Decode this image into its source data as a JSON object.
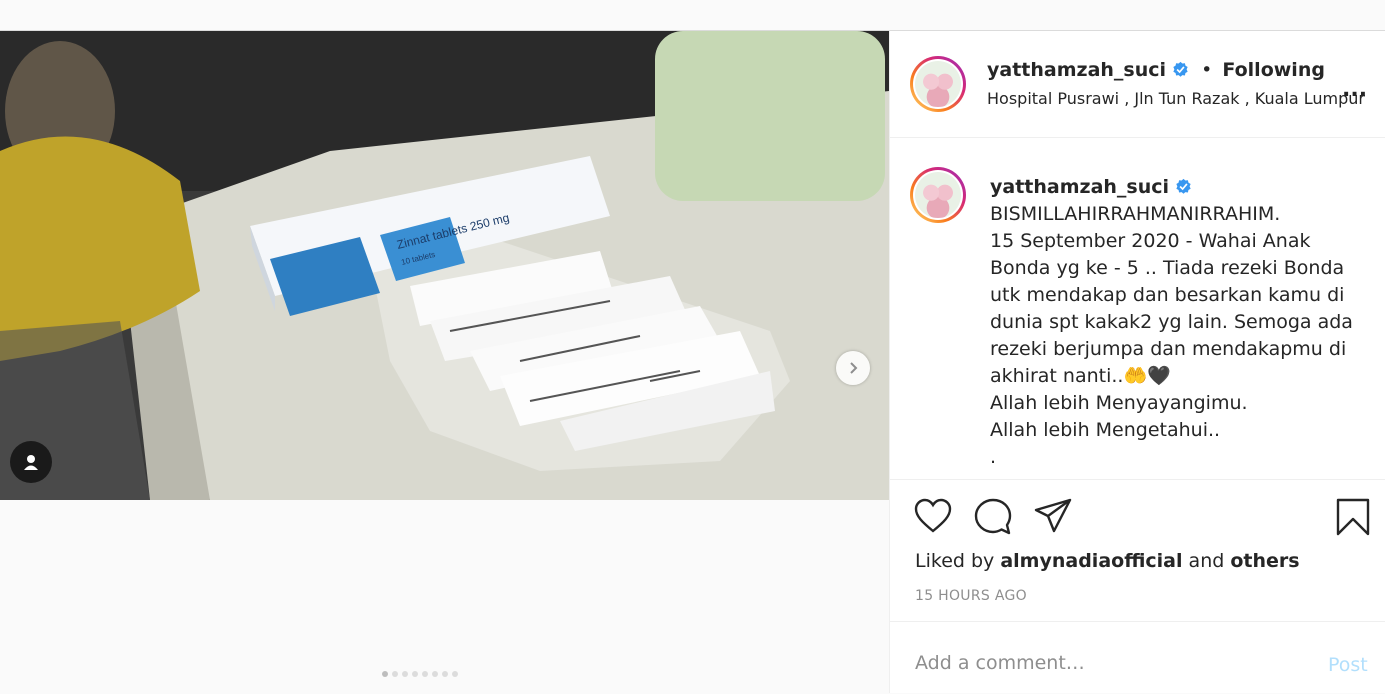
{
  "post": {
    "username": "yatthamzah_suci",
    "follow_status": "Following",
    "separator": "•",
    "location": "Hospital Pusrawi , Jln Tun Razak , Kuala Lumpur",
    "more_label": "...",
    "caption_lines": [
      "BISMILLAHIRRAHMANIRRAHIM.",
      "15 September 2020 - Wahai Anak Bonda yg ke - 5 .. Tiada rezeki Bonda utk mendakap dan besarkan kamu di dunia spt kakak2 yg lain. Semoga ada rezeki berjumpa dan mendakapmu di akhirat nanti..🤲🖤",
      "Allah lebih Menyayangimu.",
      "Allah lebih Mengetahui..",
      "."
    ],
    "liked_by_prefix": "Liked by",
    "liked_by_user": "almynadiaofficial",
    "liked_by_and": "and",
    "liked_by_others": "others",
    "time_ago": "15 HOURS AGO"
  },
  "comment": {
    "placeholder": "Add a comment…",
    "post_label": "Post"
  },
  "photo": {
    "box_label": "Zinnat tablets 250 mg",
    "box_sub": "10 tablets"
  },
  "carousel": {
    "slide_count": 8,
    "active_index": 0
  },
  "colors": {
    "verified": "#3897f0",
    "post_disabled": "#b2dffc",
    "muted": "#8e8e8e"
  },
  "icons": [
    "chevron-right-icon",
    "user-tag-icon",
    "heart-icon",
    "comment-icon",
    "share-icon",
    "bookmark-icon",
    "verified-badge-icon",
    "more-options-icon"
  ]
}
